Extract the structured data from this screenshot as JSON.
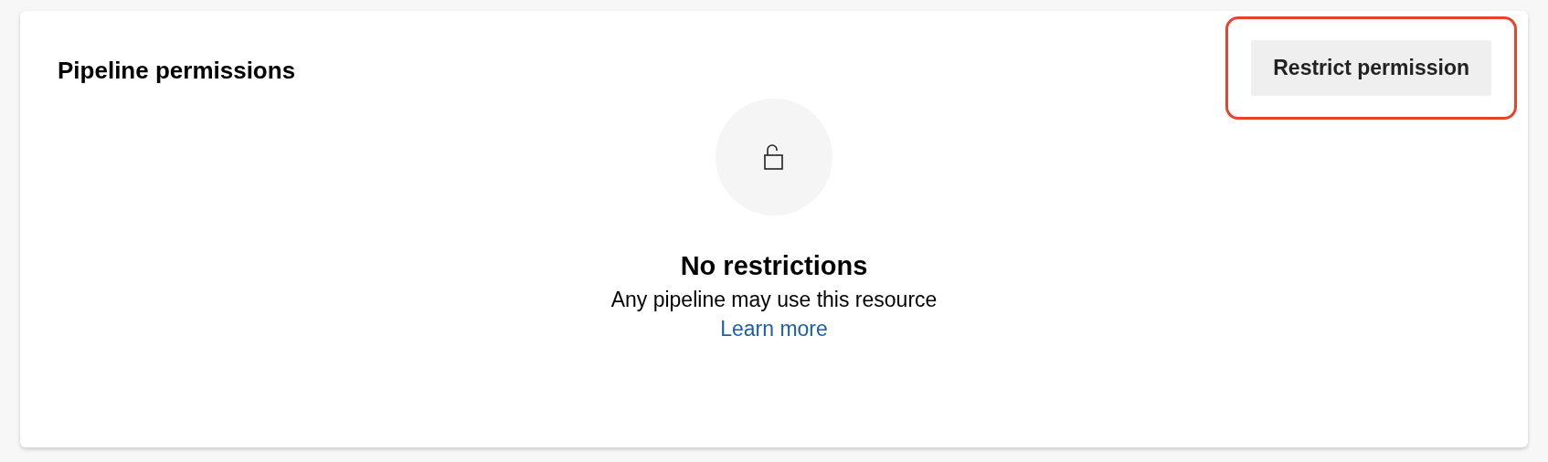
{
  "section": {
    "title": "Pipeline permissions"
  },
  "action_button": {
    "label": "Restrict permission",
    "highlighted": true
  },
  "empty_state": {
    "heading": "No restrictions",
    "message": "Any pipeline may use this resource",
    "link": "Learn more"
  }
}
